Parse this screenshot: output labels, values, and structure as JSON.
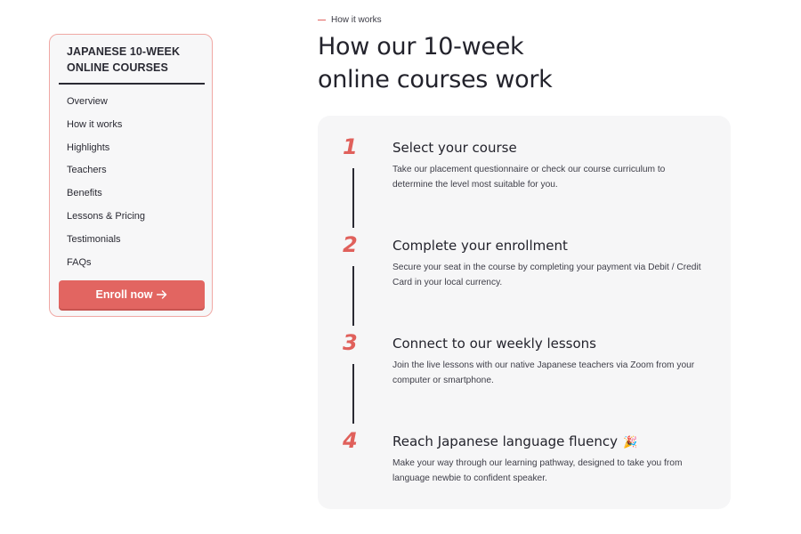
{
  "sidebar": {
    "title": "JAPANESE 10-WEEK ONLINE COURSES",
    "items": [
      {
        "label": "Overview"
      },
      {
        "label": "How it works"
      },
      {
        "label": "Highlights"
      },
      {
        "label": "Teachers"
      },
      {
        "label": "Benefits"
      },
      {
        "label": "Lessons & Pricing"
      },
      {
        "label": "Testimonials"
      },
      {
        "label": "FAQs"
      }
    ],
    "cta_label": "Enroll now",
    "cta_icon": "arrow-right-icon"
  },
  "header": {
    "eyebrow": "How it works",
    "title_line1": "How our 10-week",
    "title_line2": "online courses work"
  },
  "steps": [
    {
      "number": "1",
      "title": "Select your course",
      "description": "Take our placement questionnaire or check our course curriculum to determine the level most suitable for you."
    },
    {
      "number": "2",
      "title": "Complete your enrollment",
      "description": "Secure your seat in the course by completing your payment via Debit / Credit Card in your local currency."
    },
    {
      "number": "3",
      "title": "Connect to our weekly lessons",
      "description": "Join the live lessons with our native Japanese teachers via Zoom from your computer or smartphone."
    },
    {
      "number": "4",
      "title": "Reach Japanese language fluency",
      "description": "Make your way through our learning pathway, designed to take you from language newbie to confident speaker.",
      "icon": "party-popper-icon"
    }
  ],
  "colors": {
    "accent": "#e26561",
    "sidebar_border": "#f0a8a4",
    "card_background": "#f6f6f7",
    "text_dark": "#23232c"
  }
}
